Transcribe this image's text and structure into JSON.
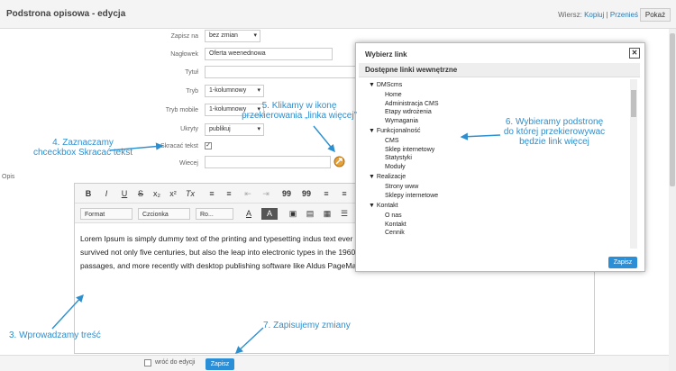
{
  "header": {
    "title": "Podstrona opisowa - edycja",
    "wiersz_label": "Wiersz:",
    "kopiuj": "Kopiuj",
    "sep": "|",
    "przenies": "Przenieś",
    "pokaz": "Pokaż"
  },
  "form": {
    "zapisz_na": {
      "label": "Zapisz na",
      "value": "bez zmian"
    },
    "naglowek": {
      "label": "Nagłowek",
      "value": "Oferta weenednowa"
    },
    "tytul": {
      "label": "Tytuł",
      "value": ""
    },
    "tryb": {
      "label": "Tryb",
      "value": "1-kolumnowy"
    },
    "tryb_mobile": {
      "label": "Tryb mobile",
      "value": "1-kolumnowy"
    },
    "ukryty": {
      "label": "Ukryty",
      "value": "publikuj"
    },
    "skracac": {
      "label": "Skracać tekst",
      "checked": "✓"
    },
    "wiecej": {
      "label": "Wiecej",
      "value": ""
    },
    "opis": "Opis"
  },
  "editor": {
    "toolbar1": [
      "B",
      "I",
      "U",
      "S",
      "x₂",
      "x²",
      "Tx",
      "≡",
      "≡",
      "⇤",
      "⇥",
      "99",
      "99",
      "≡",
      "≡"
    ],
    "toolbar2": {
      "format": "Format",
      "czcionka": "Czcionka",
      "ro": "Ro...",
      "a1": "A",
      "a2": "A"
    },
    "text": "Lorem Ipsum is simply dummy text of the printing and typesetting indus text ever since the 1500s, when an unknown printer took a galley of ty survived not only five centuries, but also the leap into electronic types in the 1960s with the release of Letraset sheets containing Lorem Ipsum passages, and more recently with desktop publishing software like Aldus PageMaker including versions of Lorem Ipsum."
  },
  "bottom": {
    "wroc": "wróć do edycji",
    "zapisz": "Zapisz"
  },
  "modal": {
    "title": "Wybierz link",
    "close": "✕",
    "heading": "Dostępne linki wewnętrzne",
    "save": "Zapisz",
    "tree": [
      {
        "label": "DMScms",
        "children": [
          "Home",
          "Administracja CMS",
          "Etapy wdrożenia",
          "Wymagania"
        ]
      },
      {
        "label": "Funkcjonalność",
        "children": [
          "CMS",
          "Sklep internetowy",
          "Statystyki",
          "Moduły"
        ]
      },
      {
        "label": "Realizacje",
        "children": [
          "Strony www",
          "Sklepy internetowe"
        ]
      },
      {
        "label": "Kontakt",
        "children": [
          "O nas",
          "Kontakt",
          "Cennik"
        ]
      }
    ]
  },
  "annotations": {
    "a4": "4. Zaznaczamy\nchceckbox Skracać tekst",
    "a5": "5. Klikamy w ikonę\nprzekierowania „linka więcej”",
    "a6": "6. Wybieramy podstronę\ndo której przekierowywac\nbędzie link więcej",
    "a3": "3. Wprowadzamy treść",
    "a7": "7. Zapisujemy zmiany"
  },
  "colors": {
    "accent": "#2a8fd6",
    "annotation": "#2c8fd0"
  }
}
